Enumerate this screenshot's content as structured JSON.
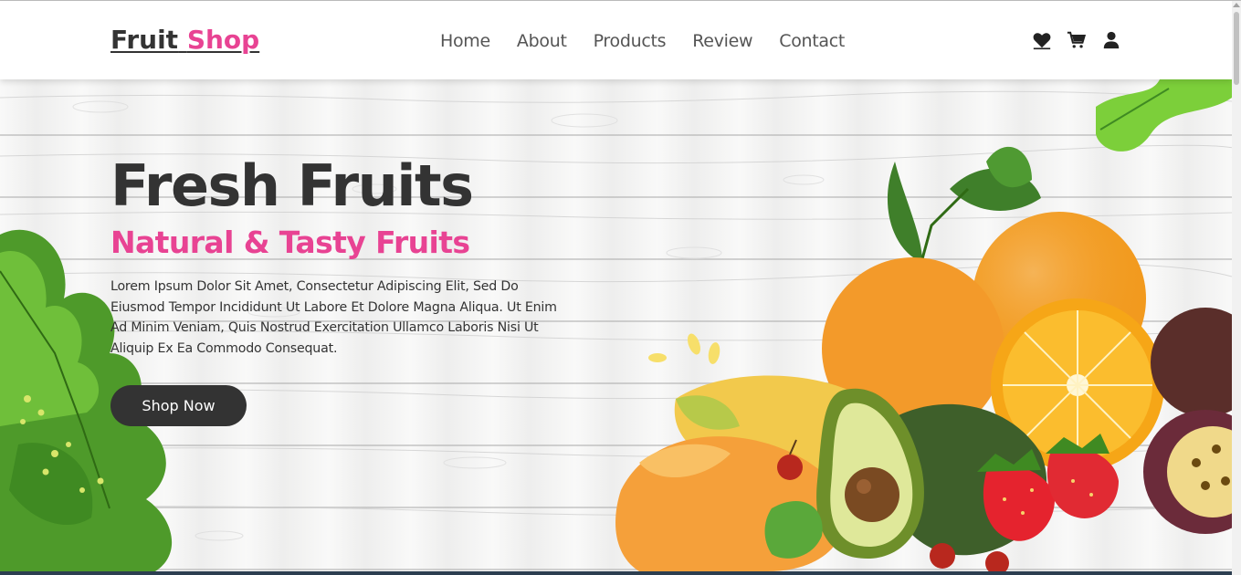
{
  "header": {
    "logo_main": "Fruit",
    "logo_accent": "Shop",
    "nav": [
      {
        "label": "Home"
      },
      {
        "label": "About"
      },
      {
        "label": "Products"
      },
      {
        "label": "Review"
      },
      {
        "label": "Contact"
      }
    ],
    "icons": [
      "heart-icon",
      "cart-icon",
      "user-icon"
    ]
  },
  "hero": {
    "title": "Fresh Fruits",
    "subtitle": "Natural & Tasty Fruits",
    "text": "Lorem Ipsum Dolor Sit Amet, Consectetur Adipiscing Elit, Sed Do Eiusmod Tempor Incididunt Ut Labore Et Dolore Magna Aliqua. Ut Enim Ad Minim Veniam, Quis Nostrud Exercitation Ullamco Laboris Nisi Ut Aliquip Ex Ea Commodo Consequat.",
    "button_label": "Shop Now"
  },
  "colors": {
    "accent": "#e84393",
    "dark": "#333333",
    "nav_text": "#555555"
  }
}
